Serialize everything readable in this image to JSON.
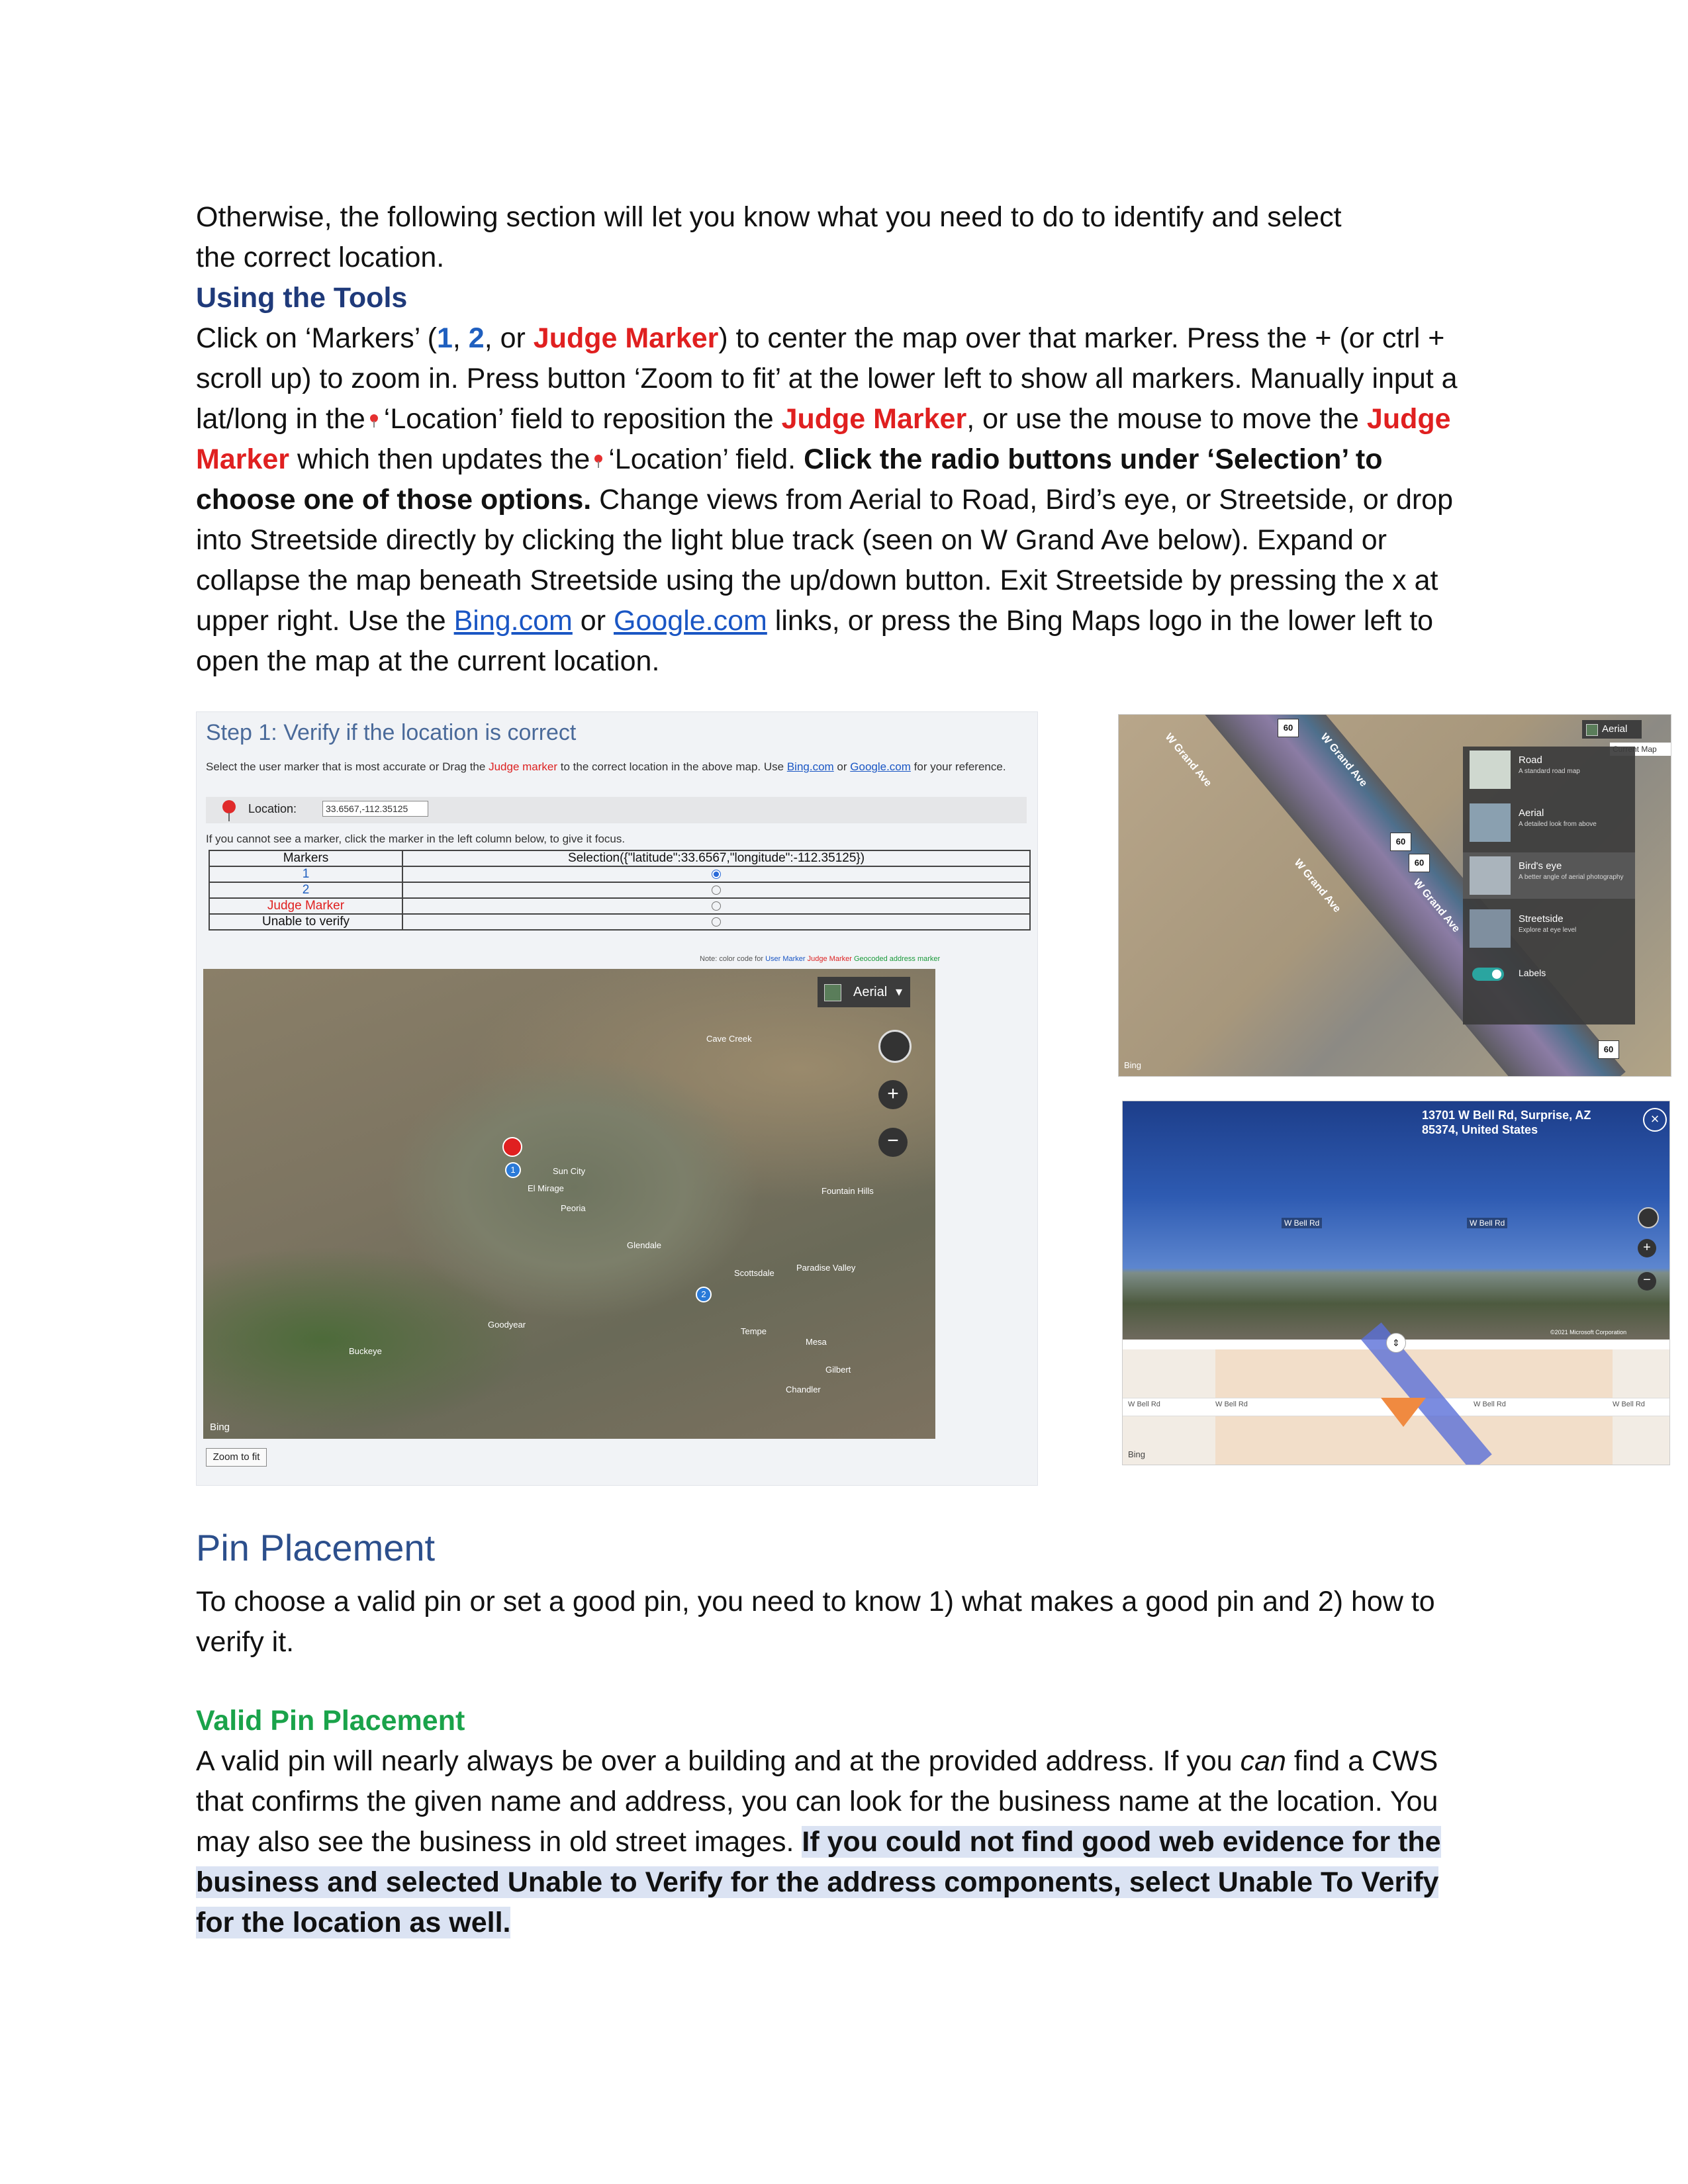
{
  "intro": {
    "line1": "Otherwise, the following section will let you know what you need to do to identify and select",
    "line2": "the correct location."
  },
  "tools": {
    "heading": "Using the Tools",
    "p_click_on": "Click on ‘Markers’ (",
    "m1": "1",
    "sep1": ", ",
    "m2": "2",
    "sep2": ", or ",
    "judge": "Judge Marker",
    "p_center": ") to center the map over that marker. Press the +  (or ctrl + scroll up) to zoom in. Press button ‘Zoom to fit’ at the lower left to show all markers. Manually input a lat/long in the",
    "p_loc1": "‘Location’ field to reposition the ",
    "judge2": "Judge Marker",
    "p_mouse": ", or use the mouse to move the ",
    "judge3": "Judge Marker",
    "p_updates": " which then updates the",
    "p_loc2": "‘Location’ field. ",
    "bold_radio": "Click the radio buttons under ‘Selection’ to choose one of those options.",
    "p_rest": " Change views from Aerial to Road, Bird’s eye, or Streetside, or drop into Streetside directly by clicking the light blue track (seen on W Grand Ave below). Expand or collapse the map beneath Streetside using the up/down button. Exit Streetside by pressing the x at upper right. Use the ",
    "bing_link": "Bing.com",
    "or": " or ",
    "google_link": "Google.com",
    "p_end": " links, or press the Bing Maps logo in the lower left to open the map at the current location."
  },
  "screenshot_left": {
    "step_title": "Step 1: Verify if the location is correct",
    "instruction_a": "Select the user marker that is most accurate or Drag the ",
    "instruction_judge": "Judge marker",
    "instruction_b": " to the correct location in the above map. Use ",
    "instruction_bing": "Bing.com",
    "instruction_c": " or ",
    "instruction_google": "Google.com",
    "instruction_d": " for your reference.",
    "location_label": "Location:",
    "location_value": "33.6567,-112.35125",
    "hint": "If you cannot see a marker, click the marker in the left column below, to give it focus.",
    "table_header_markers": "Markers",
    "table_header_selection": "Selection({\"latitude\":33.6567,\"longitude\":-112.35125})",
    "rows": [
      {
        "label": "1",
        "selected": true
      },
      {
        "label": "2",
        "selected": false
      },
      {
        "label": "Judge Marker",
        "selected": false
      },
      {
        "label": "Unable to verify",
        "selected": false
      }
    ],
    "note_prefix": "Note: color code for ",
    "note_user": "User Marker",
    "note_judge": "Judge Marker",
    "note_geo": "Geocoded address marker",
    "map_view": "Aerial",
    "map_places": [
      "Sun City",
      "Peoria",
      "Glendale",
      "Scottsdale",
      "Tempe",
      "Mesa",
      "Goodyear",
      "Buckeye",
      "Chandler",
      "Gilbert",
      "Fountain Hills",
      "El Mirage",
      "Cave Creek",
      "Paradise Valley"
    ],
    "bing_logo": "Bing",
    "zoom_to_fit": "Zoom to fit"
  },
  "screenshot_right_top": {
    "view_button": "Aerial",
    "current_map": "Current Map",
    "menu": [
      {
        "title": "Road",
        "desc": "A standard road map"
      },
      {
        "title": "Aerial",
        "desc": "A detailed look from above"
      },
      {
        "title": "Bird's eye",
        "desc": "A better angle of aerial photography"
      },
      {
        "title": "Streetside",
        "desc": "Explore at eye level"
      }
    ],
    "labels_toggle": "Labels",
    "streets": [
      "W Grand Ave",
      "W Grand Ave",
      "W Grand Ave",
      "W Grand Ave"
    ],
    "shields": [
      "60",
      "60",
      "60",
      "60"
    ],
    "bing": "Bing"
  },
  "screenshot_right_bottom": {
    "address_line1": "13701 W Bell Rd, Surprise, AZ",
    "address_line2": "85374, United States",
    "left_arrow": "W Bell Rd",
    "right_arrow": "W Bell Rd",
    "copyright": "©2021 Microsoft Corporation",
    "road_labels": [
      "W Bell Rd",
      "W Bell Rd",
      "W Bell Rd",
      "W Bell Rd"
    ],
    "bing": "Bing"
  },
  "pin": {
    "heading": "Pin Placement",
    "intro": "To choose a valid pin or set a good pin, you need to know 1) what makes a good pin and 2) how to verify it.",
    "valid_heading": "Valid Pin Placement",
    "valid_a": "A valid pin will nearly always be over a building and at the provided address. If you ",
    "valid_can": "can",
    "valid_b": " find a CWS that confirms the given name and address, you can look for the business name at the location. You may also see the business in old street images.  ",
    "valid_bold": "If you could not find good web evidence for the business and selected Unable to Verify for the address components, select Unable To Verify for the location as well."
  },
  "colors": {
    "heading_blue": "#1f3a7a",
    "marker_blue": "#1f5fbf",
    "judge_red": "#e02020",
    "valid_green": "#1aa34a",
    "section_blue": "#2c4f8c",
    "highlight": "#dbe3f3"
  }
}
